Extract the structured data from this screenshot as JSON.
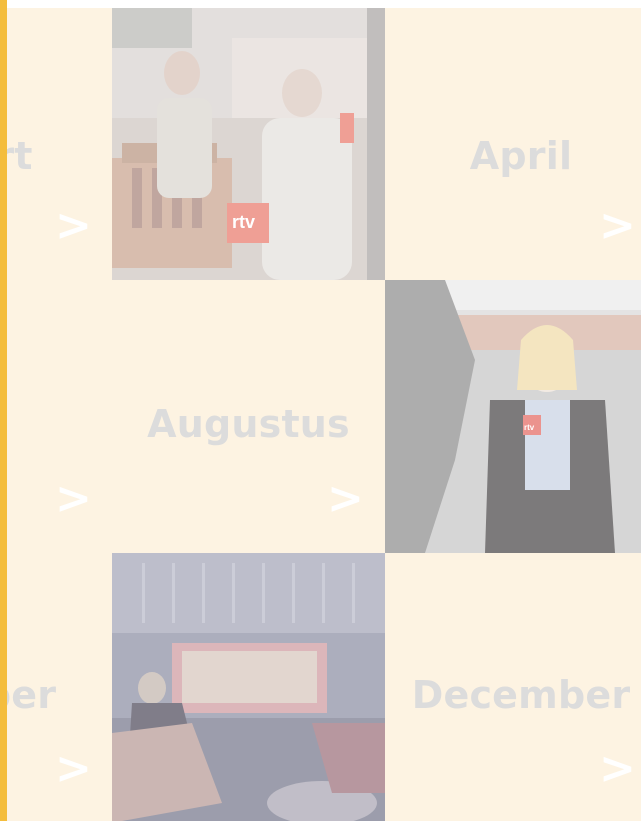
{
  "tiles": {
    "maart": {
      "label_visible": "rt",
      "arrow": ">"
    },
    "april": {
      "label": "April",
      "arrow": ">"
    },
    "juni": {
      "arrow": ">"
    },
    "augustus": {
      "label": "Augustus",
      "arrow": ">"
    },
    "oktober": {
      "label_visible": "ber",
      "arrow": ">"
    },
    "december": {
      "label": "December",
      "arrow": ">"
    }
  },
  "photos": {
    "studio_rtv": {
      "logo_text": "rtv"
    },
    "reporter_outdoor": {
      "mic_text": "rtv"
    },
    "tv_stage": {}
  },
  "colors": {
    "accent_bar": "#f4bd3c",
    "tile_bg": "#fdf3e2",
    "label_text": "#dcdcdc",
    "arrow": "#ffffff"
  },
  "icons": [
    "chevron-right-icon"
  ]
}
